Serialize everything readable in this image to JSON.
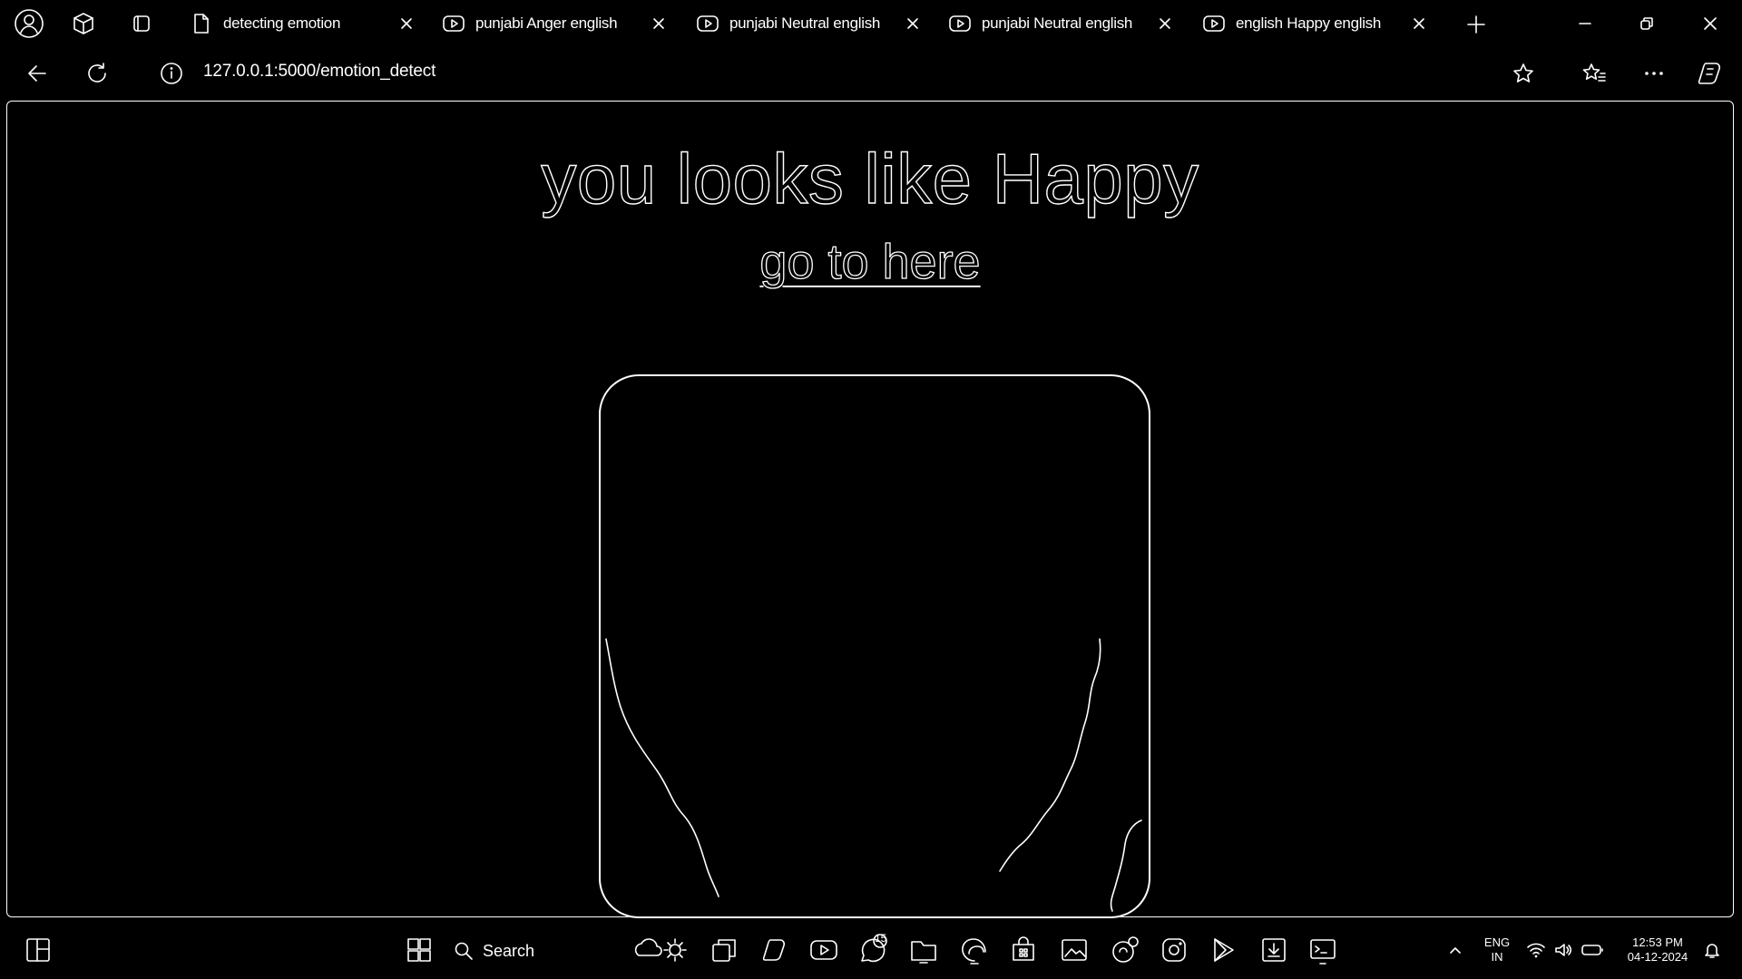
{
  "browser": {
    "tabs": [
      {
        "title": "detecting emotion",
        "icon": "page-icon"
      },
      {
        "title": "punjabi Anger english",
        "icon": "youtube-icon"
      },
      {
        "title": "punjabi Neutral english",
        "icon": "youtube-icon"
      },
      {
        "title": "punjabi Neutral english",
        "icon": "youtube-icon"
      },
      {
        "title": "english Happy english",
        "icon": "youtube-icon"
      }
    ],
    "url": "127.0.0.1:5000/emotion_detect"
  },
  "page": {
    "headline": "you looks like Happy",
    "link_text": "go to here"
  },
  "taskbar": {
    "search_label": "Search",
    "notification_badge": "15",
    "language_line1": "ENG",
    "language_line2": "IN",
    "time": "12:53 PM",
    "date": "04-12-2024"
  },
  "colors": {
    "background": "#000000",
    "foreground": "#ffffff"
  }
}
